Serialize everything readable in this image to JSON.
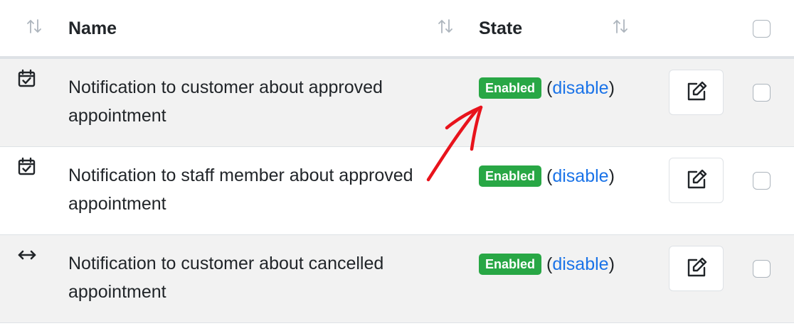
{
  "table": {
    "columns": {
      "name": "Name",
      "state": "State"
    },
    "rows": [
      {
        "icon": "calendar-check-icon",
        "name": "Notification to customer about approved appointment",
        "badge": "Enabled",
        "open_paren": "(",
        "action": "disable",
        "close_paren": ")"
      },
      {
        "icon": "calendar-check-icon",
        "name": "Notification to staff member about approved appointment",
        "badge": "Enabled",
        "open_paren": "(",
        "action": "disable",
        "close_paren": ")"
      },
      {
        "icon": "arrows-horizontal-icon",
        "name": "Notification to customer about cancelled appointment",
        "badge": "Enabled",
        "open_paren": "(",
        "action": "disable",
        "close_paren": ")"
      }
    ]
  },
  "colors": {
    "badge": "#28a745",
    "link": "#1a73e8",
    "stripe": "#f2f2f2",
    "annotation_arrow": "#e8131c"
  },
  "icons": {
    "sort": "sort-arrows-icon",
    "edit": "edit-pencil-icon",
    "annotation": "hand-drawn-red-arrow"
  }
}
